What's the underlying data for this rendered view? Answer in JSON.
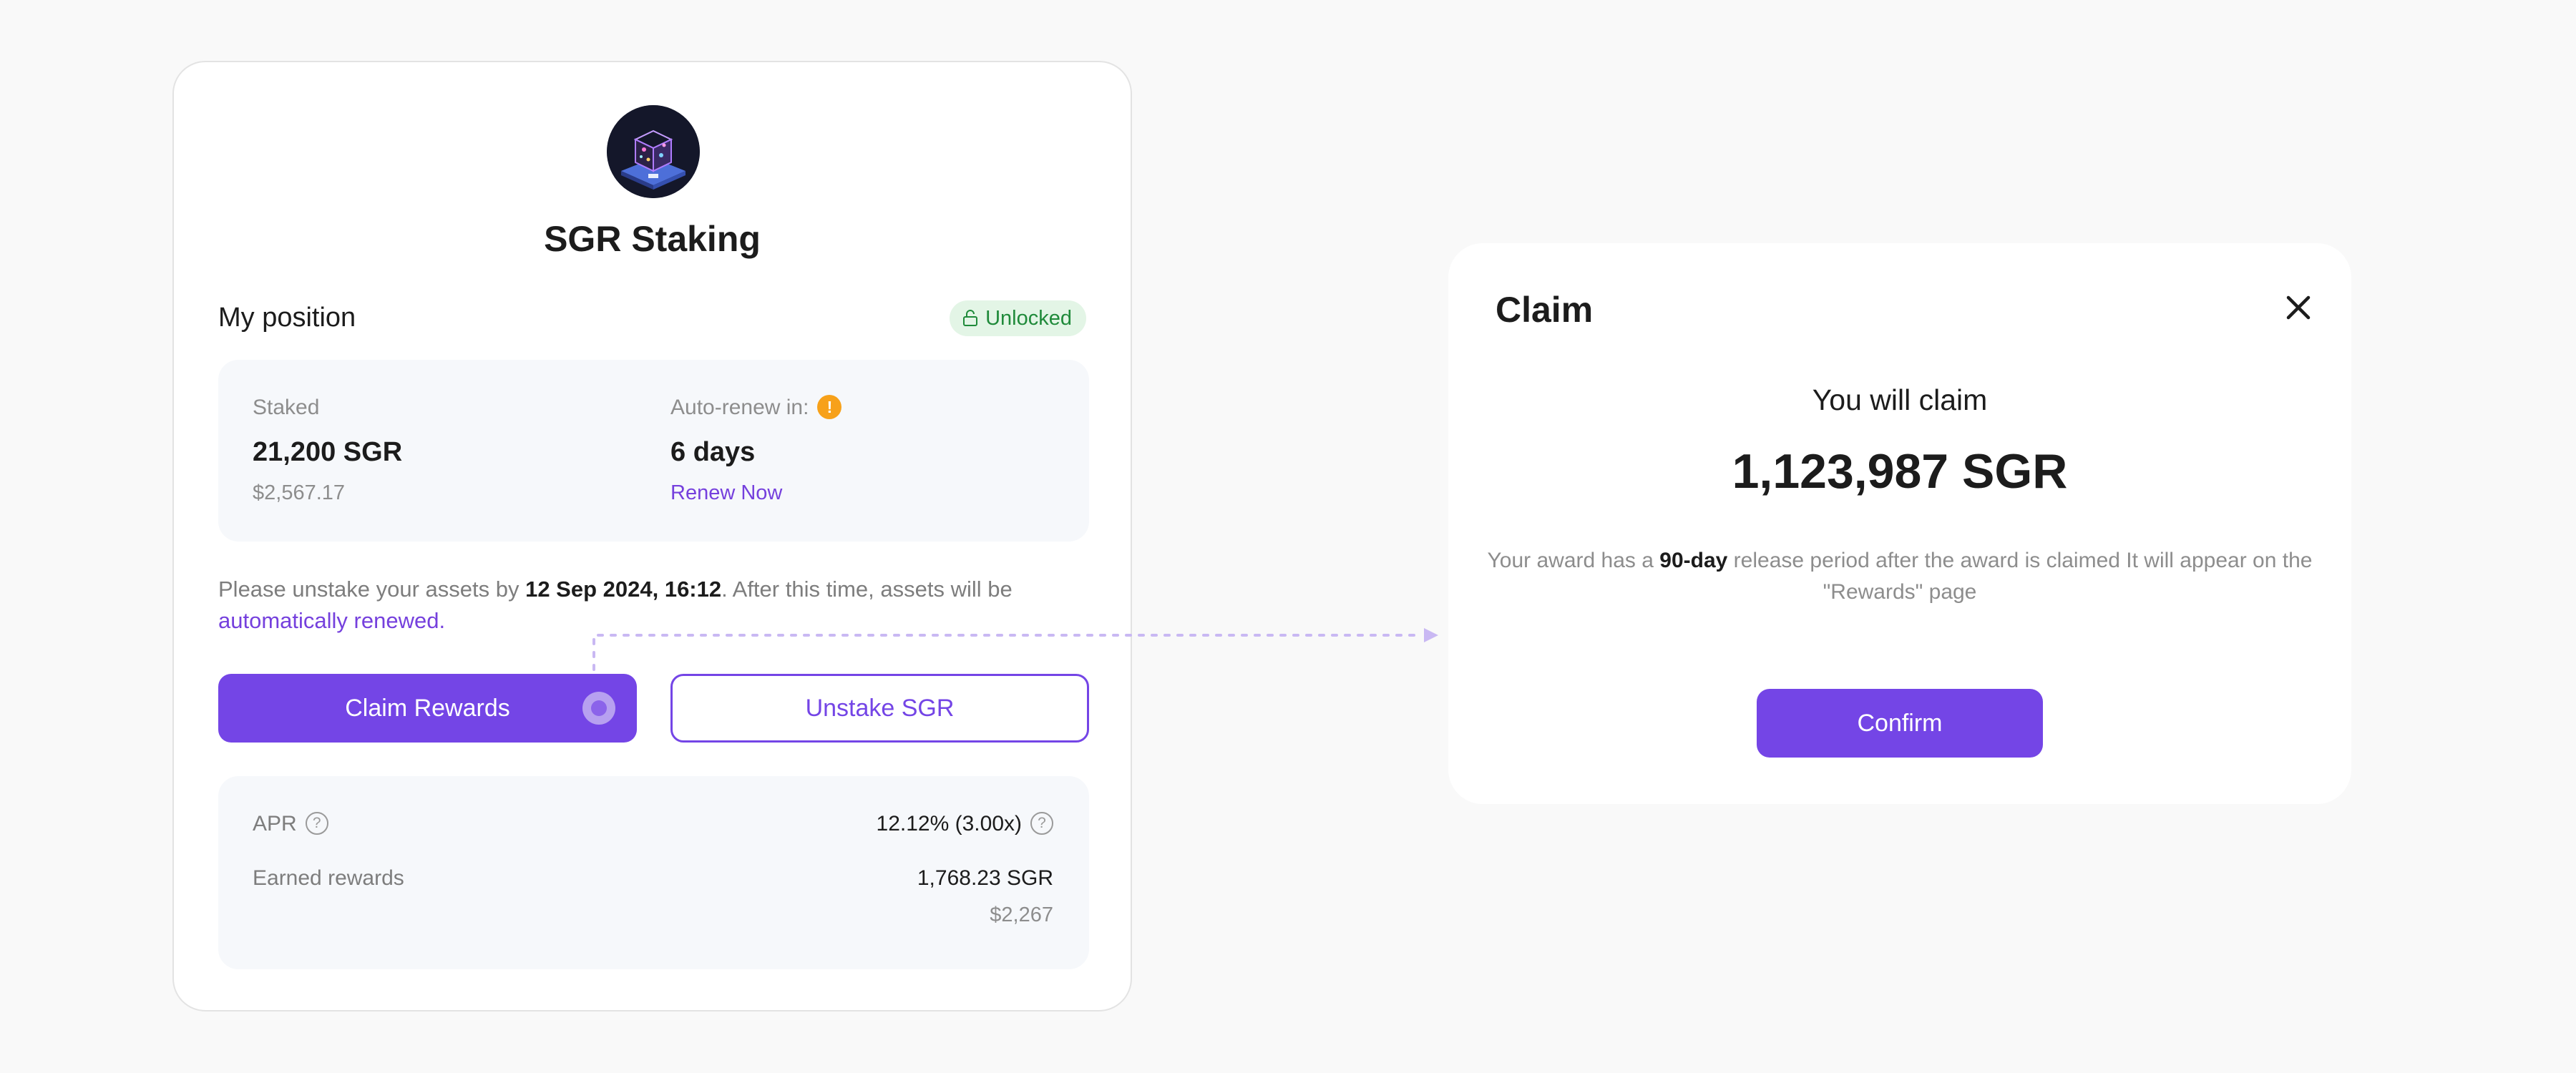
{
  "staking": {
    "title": "SGR Staking",
    "logo_icon": "cube-logo-icon",
    "position_label": "My position",
    "status_badge": "Unlocked",
    "staked_label": "Staked",
    "staked_amount": "21,200 SGR",
    "staked_usd": "$2,567.17",
    "autorenew_label": "Auto-renew in:",
    "autorenew_value": "6 days",
    "renew_link": "Renew Now",
    "notice": {
      "prefix": "Please unstake your assets by ",
      "date": "12 Sep 2024, 16:12",
      "middle": ". After this time, assets will be ",
      "link": "automatically renewed",
      "suffix": "."
    },
    "claim_button": "Claim Rewards",
    "unstake_button": "Unstake SGR",
    "apr_label": "APR",
    "apr_value": "12.12% (3.00x)",
    "earned_label": "Earned rewards",
    "earned_value": "1,768.23 SGR",
    "earned_usd": "$2,267"
  },
  "modal": {
    "title": "Claim",
    "subtitle": "You will claim",
    "amount": "1,123,987 SGR",
    "desc_prefix": "Your award has a ",
    "desc_bold": "90-day",
    "desc_suffix": " release period after the award is claimed It will appear on the \"Rewards\" page",
    "confirm_button": "Confirm"
  },
  "colors": {
    "accent": "#7445e6",
    "link": "#7540dd",
    "success_bg": "#e3f5e6",
    "success_text": "#1f8a3a",
    "warning": "#f7a11a"
  }
}
